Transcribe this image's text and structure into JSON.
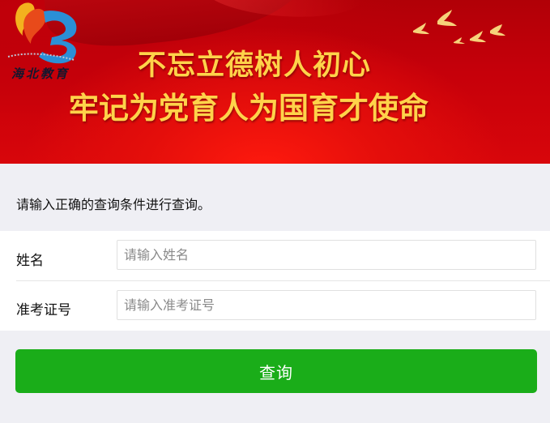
{
  "banner": {
    "logo_text": "海北教育",
    "slogan_line1": "不忘立德树人初心",
    "slogan_line2": "牢记为党育人为国育才使命"
  },
  "hint": "请输入正确的查询条件进行查询。",
  "form": {
    "name_label": "姓名",
    "name_placeholder": "请输入姓名",
    "name_value": "",
    "exam_id_label": "准考证号",
    "exam_id_placeholder": "请输入准考证号",
    "exam_id_value": ""
  },
  "query_button": "查询",
  "colors": {
    "banner_red": "#c6000a",
    "slogan_gold": "#ffd34a",
    "button_green": "#1aad19",
    "page_bg": "#efeff4"
  }
}
